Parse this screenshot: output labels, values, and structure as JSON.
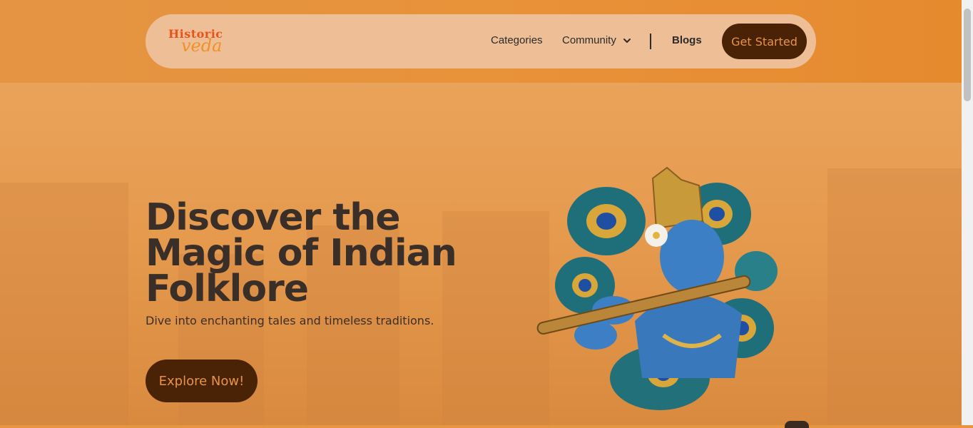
{
  "logo": {
    "line1": "Historic",
    "line2": "veda"
  },
  "nav": {
    "links": [
      "Categories",
      "Community",
      "Blogs"
    ],
    "cta_label": "Get Started"
  },
  "hero": {
    "headline_lines": [
      "Discover the",
      "Magic of Indian",
      "Folklore"
    ],
    "subtitle": "Dive into enchanting tales and timeless traditions.",
    "button_label": "Explore Now!"
  },
  "colors": {
    "accent_dark": "#4a2307",
    "accent_text": "#e8934a",
    "nav_bg": "#eebf97",
    "background": "#e8953f"
  },
  "icons": [
    "chevron-down-icon",
    "krishna-flute-illustration"
  ]
}
